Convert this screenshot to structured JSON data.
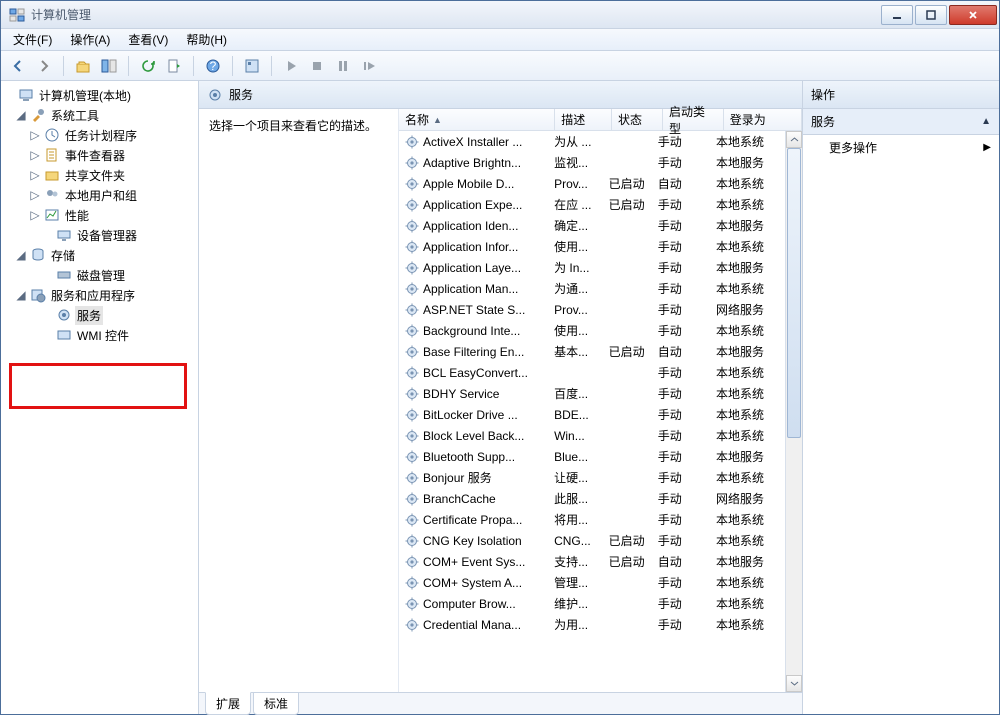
{
  "window": {
    "title": "计算机管理",
    "ghost_tabs": [
      "",
      "",
      ""
    ]
  },
  "menu": [
    "文件(F)",
    "操作(A)",
    "查看(V)",
    "帮助(H)"
  ],
  "tree": {
    "root": "计算机管理(本地)",
    "sys_tools": "系统工具",
    "task_sched": "任务计划程序",
    "event_viewer": "事件查看器",
    "shared": "共享文件夹",
    "users": "本地用户和组",
    "perf": "性能",
    "devmgr": "设备管理器",
    "storage": "存储",
    "diskmgmt": "磁盘管理",
    "services_apps": "服务和应用程序",
    "services": "服务",
    "wmi": "WMI 控件"
  },
  "center": {
    "title": "服务",
    "desc_prompt": "选择一个项目来查看它的描述。",
    "columns": {
      "name": "名称",
      "desc": "描述",
      "status": "状态",
      "startup": "启动类型",
      "logon": "登录为"
    },
    "tabs": {
      "ext": "扩展",
      "std": "标准"
    }
  },
  "services": [
    {
      "name": "ActiveX Installer ...",
      "desc": "为从 ...",
      "status": "",
      "startup": "手动",
      "logon": "本地系统"
    },
    {
      "name": "Adaptive Brightn...",
      "desc": "监视...",
      "status": "",
      "startup": "手动",
      "logon": "本地服务"
    },
    {
      "name": "Apple Mobile D...",
      "desc": "Prov...",
      "status": "已启动",
      "startup": "自动",
      "logon": "本地系统"
    },
    {
      "name": "Application Expe...",
      "desc": "在应 ...",
      "status": "已启动",
      "startup": "手动",
      "logon": "本地系统"
    },
    {
      "name": "Application Iden...",
      "desc": "确定...",
      "status": "",
      "startup": "手动",
      "logon": "本地服务"
    },
    {
      "name": "Application Infor...",
      "desc": "使用...",
      "status": "",
      "startup": "手动",
      "logon": "本地系统"
    },
    {
      "name": "Application Laye...",
      "desc": "为 In...",
      "status": "",
      "startup": "手动",
      "logon": "本地服务"
    },
    {
      "name": "Application Man...",
      "desc": "为通...",
      "status": "",
      "startup": "手动",
      "logon": "本地系统"
    },
    {
      "name": "ASP.NET State S...",
      "desc": "Prov...",
      "status": "",
      "startup": "手动",
      "logon": "网络服务"
    },
    {
      "name": "Background Inte...",
      "desc": "使用...",
      "status": "",
      "startup": "手动",
      "logon": "本地系统"
    },
    {
      "name": "Base Filtering En...",
      "desc": "基本...",
      "status": "已启动",
      "startup": "自动",
      "logon": "本地服务"
    },
    {
      "name": "BCL EasyConvert...",
      "desc": "",
      "status": "",
      "startup": "手动",
      "logon": "本地系统"
    },
    {
      "name": "BDHY Service",
      "desc": "百度...",
      "status": "",
      "startup": "手动",
      "logon": "本地系统"
    },
    {
      "name": "BitLocker Drive ...",
      "desc": "BDE...",
      "status": "",
      "startup": "手动",
      "logon": "本地系统"
    },
    {
      "name": "Block Level Back...",
      "desc": "Win...",
      "status": "",
      "startup": "手动",
      "logon": "本地系统"
    },
    {
      "name": "Bluetooth Supp...",
      "desc": "Blue...",
      "status": "",
      "startup": "手动",
      "logon": "本地服务"
    },
    {
      "name": "Bonjour 服务",
      "desc": "让硬...",
      "status": "",
      "startup": "手动",
      "logon": "本地系统"
    },
    {
      "name": "BranchCache",
      "desc": "此服...",
      "status": "",
      "startup": "手动",
      "logon": "网络服务"
    },
    {
      "name": "Certificate Propa...",
      "desc": "将用...",
      "status": "",
      "startup": "手动",
      "logon": "本地系统"
    },
    {
      "name": "CNG Key Isolation",
      "desc": "CNG...",
      "status": "已启动",
      "startup": "手动",
      "logon": "本地系统"
    },
    {
      "name": "COM+ Event Sys...",
      "desc": "支持...",
      "status": "已启动",
      "startup": "自动",
      "logon": "本地服务"
    },
    {
      "name": "COM+ System A...",
      "desc": "管理...",
      "status": "",
      "startup": "手动",
      "logon": "本地系统"
    },
    {
      "name": "Computer Brow...",
      "desc": "维护...",
      "status": "",
      "startup": "手动",
      "logon": "本地系统"
    },
    {
      "name": "Credential Mana...",
      "desc": "为用...",
      "status": "",
      "startup": "手动",
      "logon": "本地系统"
    }
  ],
  "actions": {
    "header": "操作",
    "section": "服务",
    "more": "更多操作"
  }
}
